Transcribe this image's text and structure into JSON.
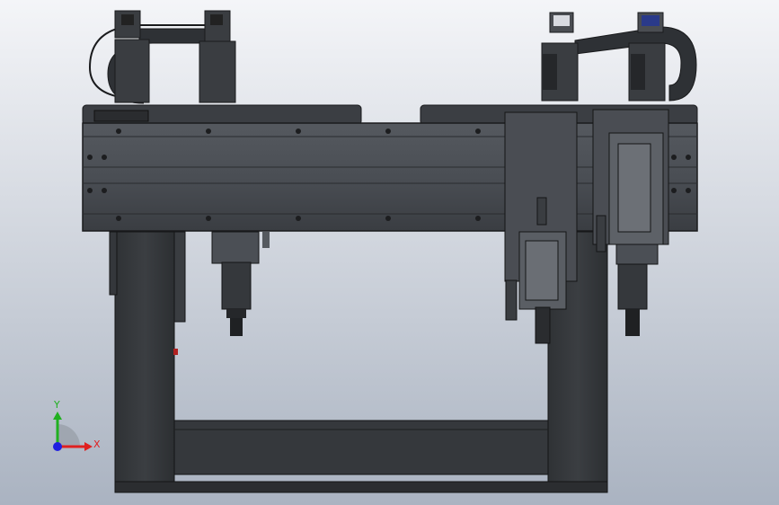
{
  "viewport": {
    "background_top": "#f4f5f8",
    "background_bottom": "#aab3c1",
    "model_color": "#3c3f44"
  },
  "triad": {
    "x_label": "X",
    "y_label": "Y",
    "x_color": "#e02020",
    "y_color": "#20b020",
    "z_color": "#2020e0"
  }
}
